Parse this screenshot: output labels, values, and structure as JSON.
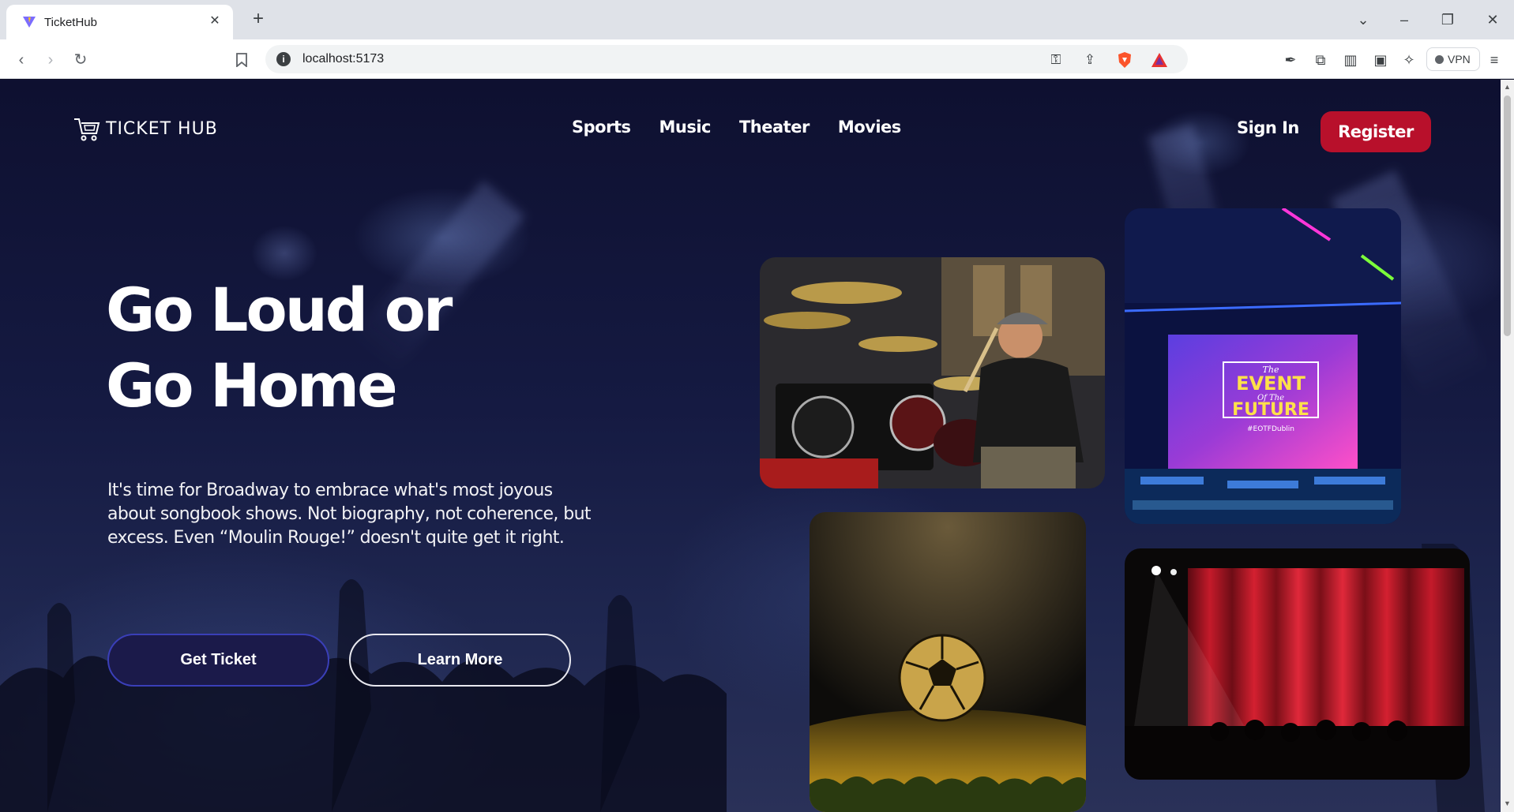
{
  "browser": {
    "tab_title": "TicketHub",
    "url": "localhost:5173",
    "vpn_label": "VPN"
  },
  "header": {
    "logo_text": "TICKET HUB",
    "nav": [
      "Sports",
      "Music",
      "Theater",
      "Movies"
    ],
    "sign_in": "Sign In",
    "register": "Register"
  },
  "hero": {
    "title_line1": "Go Loud or",
    "title_line2": "Go Home",
    "description": "It's time for Broadway to embrace what's most joyous about songbook shows. Not biography, not coherence, but excess. Even “Moulin Rouge!” doesn't quite get it right.",
    "primary_button": "Get Ticket",
    "secondary_button": "Learn More"
  },
  "gallery": {
    "event_card_text_line1": "The",
    "event_card_text_line2": "EVENT",
    "event_card_text_line3": "Of The",
    "event_card_text_line4": "FUTURE",
    "event_card_hashtag": "#EOTFDublin"
  },
  "colors": {
    "brand_red": "#b8102b",
    "primary_button": "#1b1a4a",
    "page_background": "#0e1030"
  }
}
